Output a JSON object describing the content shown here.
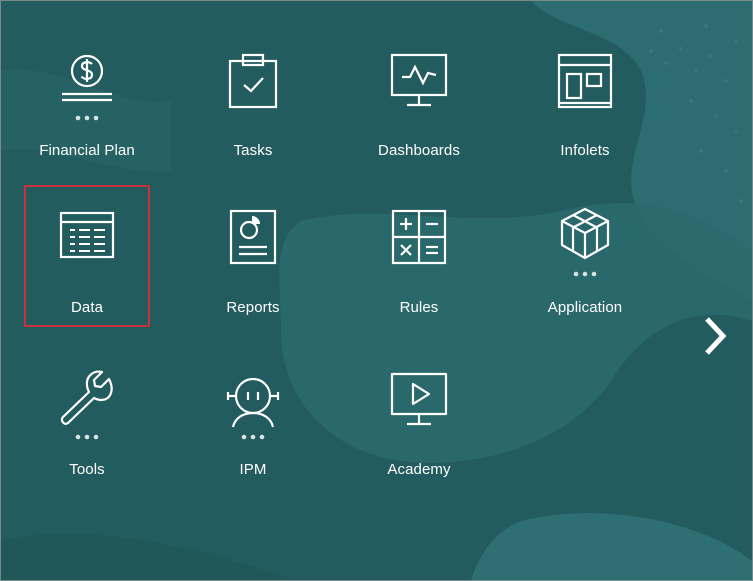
{
  "tiles": [
    {
      "label": "Financial Plan",
      "icon": "dollar-coin-icon",
      "more": true
    },
    {
      "label": "Tasks",
      "icon": "clipboard-check-icon",
      "more": false
    },
    {
      "label": "Dashboards",
      "icon": "monitor-pulse-icon",
      "more": false
    },
    {
      "label": "Infolets",
      "icon": "infolet-panels-icon",
      "more": false
    },
    {
      "label": "Data",
      "icon": "data-grid-icon",
      "more": false,
      "selected": true
    },
    {
      "label": "Reports",
      "icon": "report-pie-icon",
      "more": false
    },
    {
      "label": "Rules",
      "icon": "calculator-icon",
      "more": false
    },
    {
      "label": "Application",
      "icon": "cube-icon",
      "more": true
    },
    {
      "label": "Tools",
      "icon": "wrench-icon",
      "more": true
    },
    {
      "label": "IPM",
      "icon": "robot-head-icon",
      "more": true
    },
    {
      "label": "Academy",
      "icon": "play-monitor-icon",
      "more": false
    }
  ],
  "navigation": {
    "next_icon": "chevron-right-icon"
  },
  "colors": {
    "background": "#235c5e",
    "accent_light": "#2f7476",
    "selection": "#c8323a",
    "icon": "#ffffff"
  }
}
